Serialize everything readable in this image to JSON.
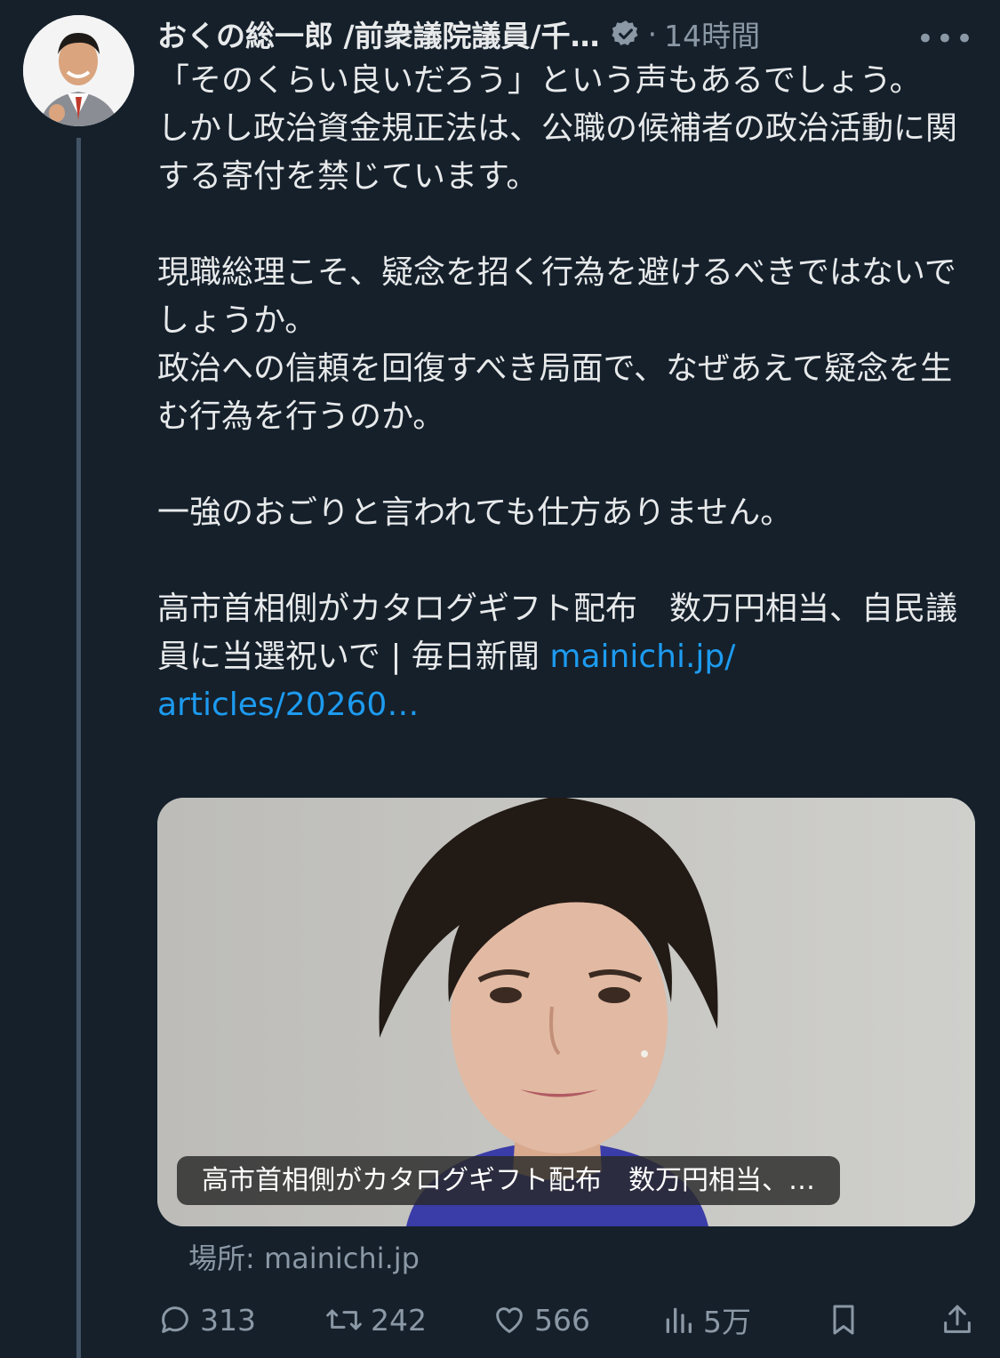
{
  "post": {
    "author_name": "おくの総一郎 /前衆議院議員/千…",
    "separator": "·",
    "timestamp": "14時間",
    "more_label": "•••",
    "text_part1": "「そのくらい良いだろう」という声もあるでしょう。\nしかし政治資金規正法は、公職の候補者の政治活動に関する寄付を禁じています。\n\n現職総理こそ、疑念を招く行為を避けるべきではないでしょうか。\n政治への信頼を回復すべき局面で、なぜあえて疑念を生む行為を行うのか。\n\n一強のおごりと言われても仕方ありません。\n\n高市首相側がカタログギフト配布　数万円相当、自民議員に当選祝いで | 毎日新聞 ",
    "link_line1": "mainichi.jp/",
    "link_line2": "articles/20260…"
  },
  "card": {
    "caption": "高市首相側がカタログギフト配布　数万円相当、…",
    "source": "場所: mainichi.jp"
  },
  "actions": {
    "replies": "313",
    "reposts": "242",
    "likes": "566",
    "views": "5万"
  },
  "colors": {
    "background": "#15202b",
    "text": "#e7e9ea",
    "muted": "#8b98a5",
    "link": "#1d9bf0"
  }
}
